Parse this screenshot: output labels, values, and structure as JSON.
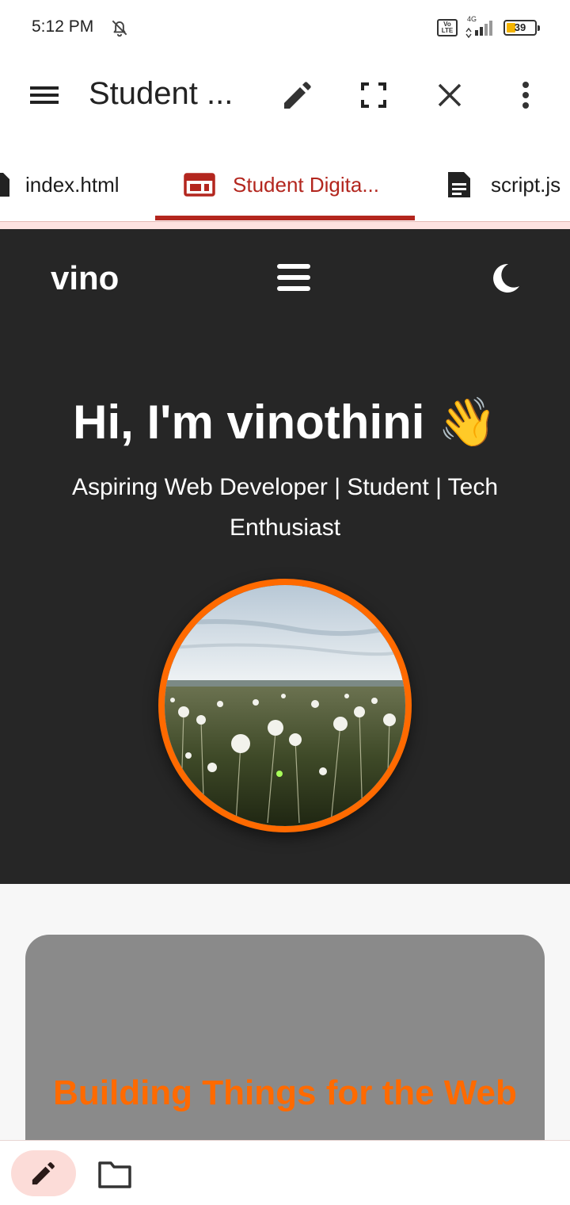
{
  "status_bar": {
    "time": "5:12 PM",
    "network": "4G",
    "battery": "39",
    "icons": [
      "bell-off-icon",
      "volte-icon",
      "signal-icon",
      "battery-icon"
    ]
  },
  "toolbar": {
    "title": "Student ...",
    "icons": [
      "menu-icon",
      "edit-icon",
      "fullscreen-icon",
      "close-icon",
      "more-vert-icon"
    ]
  },
  "tabs": [
    {
      "label": "index.html",
      "icon": "file-icon",
      "active": false
    },
    {
      "label": "Student Digita...",
      "icon": "web-preview-icon",
      "active": true
    },
    {
      "label": "script.js",
      "icon": "document-icon",
      "active": false
    }
  ],
  "preview": {
    "logo": "vino",
    "hero_title": "Hi, I'm vinothini 👋",
    "hero_subtitle": "Aspiring Web Developer | Student | Tech Enthusiast",
    "card_title": "Building Things for the Web",
    "colors": {
      "hero_bg": "#262626",
      "accent": "#ff6a00",
      "card_bg": "#8a8a8a"
    }
  },
  "bottom_bar": {
    "icons": [
      "edit-icon",
      "folder-icon"
    ]
  },
  "accent_color": "#b3261e"
}
